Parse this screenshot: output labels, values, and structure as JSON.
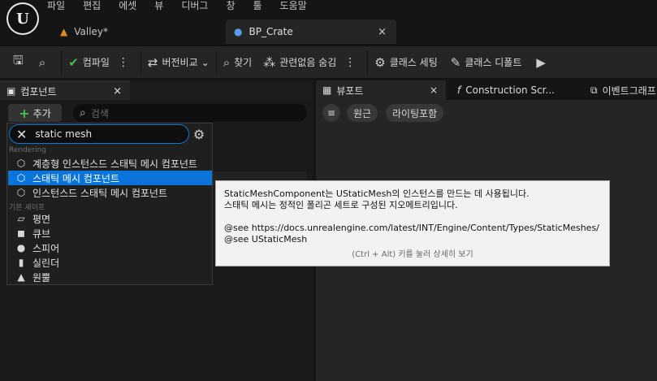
{
  "menu": [
    "파일",
    "편집",
    "에셋",
    "뷰",
    "디버그",
    "창",
    "툴",
    "도움말"
  ],
  "tabs": [
    {
      "label": "Valley*",
      "icon": "landscape-icon"
    },
    {
      "label": "BP_Crate",
      "icon": "blueprint-icon",
      "close": "×"
    }
  ],
  "toolbar": {
    "compile": "컴파일",
    "diff": "버전비교",
    "find": "찾기",
    "hide_unrelated": "관련없음 숨김",
    "class_settings": "클래스 세팅",
    "class_defaults": "클래스 디폴트"
  },
  "components_panel": {
    "title": "컴포넌트",
    "close": "×",
    "add_label": "추가",
    "search_placeholder": "검색"
  },
  "dropdown": {
    "search_value": "static mesh",
    "section_rendering": "Rendering",
    "section_basic": "기본 셰이프",
    "rendering_items": [
      {
        "label": "계층형 인스턴스드 스태틱 메시 컴포넌트",
        "icon": "mesh-icon"
      },
      {
        "label": "스태틱 메시 컴포넌트",
        "icon": "mesh-icon",
        "selected": true
      },
      {
        "label": "인스턴스드 스태틱 메시 컴포넌트",
        "icon": "mesh-icon"
      }
    ],
    "shape_items": [
      {
        "label": "평면",
        "icon": "plane-icon"
      },
      {
        "label": "큐브",
        "icon": "cube-icon"
      },
      {
        "label": "스피어",
        "icon": "sphere-icon"
      },
      {
        "label": "실린더",
        "icon": "cylinder-icon"
      },
      {
        "label": "원뿔",
        "icon": "cone-icon"
      }
    ]
  },
  "right_tabs": {
    "viewport": "뷰포트",
    "construction": "Construction Scr...",
    "event_graph": "이벤트그래프"
  },
  "viewport": {
    "btn_perspective": "원근",
    "btn_lighting": "라이팅포함"
  },
  "tooltip": {
    "line1": "StaticMeshComponent는 UStaticMesh의 인스턴스를 만드는 데 사용됩니다.",
    "line2": "스태틱 메시는 정적인 폴리곤 세트로 구성된 지오메트리입니다.",
    "line3": "@see https://docs.unrealengine.com/latest/INT/Engine/Content/Types/StaticMeshes/",
    "line4": "@see UStaticMesh",
    "hint": "(Ctrl + Alt) 키를 눌러 상세히 보기"
  }
}
